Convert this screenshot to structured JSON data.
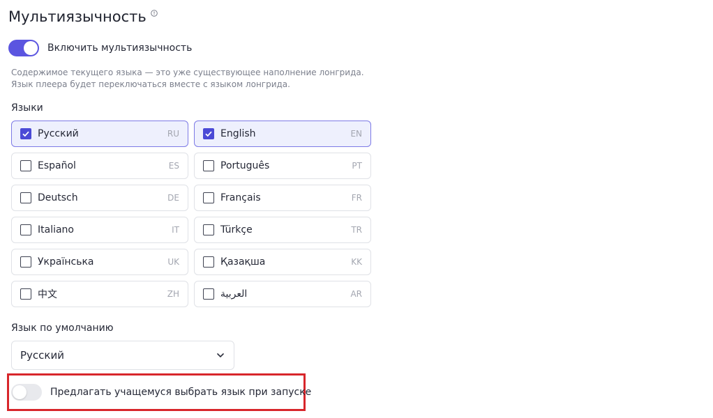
{
  "header": {
    "title": "Мультиязычность",
    "info_icon": "info-icon"
  },
  "multilang_toggle": {
    "label": "Включить мультиязычность",
    "on": true
  },
  "description": "Содержимое текущего языка — это уже существующее наполнение лонгрида. Язык плеера будет переключаться вместе с языком лонгрида.",
  "languages_section": {
    "label": "Языки",
    "items": [
      {
        "name": "Русский",
        "code": "RU",
        "checked": true
      },
      {
        "name": "English",
        "code": "EN",
        "checked": true
      },
      {
        "name": "Español",
        "code": "ES",
        "checked": false
      },
      {
        "name": "Português",
        "code": "PT",
        "checked": false
      },
      {
        "name": "Deutsch",
        "code": "DE",
        "checked": false
      },
      {
        "name": "Français",
        "code": "FR",
        "checked": false
      },
      {
        "name": "Italiano",
        "code": "IT",
        "checked": false
      },
      {
        "name": "Türkçe",
        "code": "TR",
        "checked": false
      },
      {
        "name": "Українська",
        "code": "UK",
        "checked": false
      },
      {
        "name": "Қазақша",
        "code": "KK",
        "checked": false
      },
      {
        "name": "中文",
        "code": "ZH",
        "checked": false
      },
      {
        "name": "العربية",
        "code": "AR",
        "checked": false
      }
    ]
  },
  "default_language": {
    "label": "Язык по умолчанию",
    "value": "Русский"
  },
  "prompt_toggle": {
    "label": "Предлагать учащемуся выбрать язык при запуске",
    "on": false
  },
  "colors": {
    "accent": "#5b55e0",
    "highlight_border": "#d8262b"
  }
}
